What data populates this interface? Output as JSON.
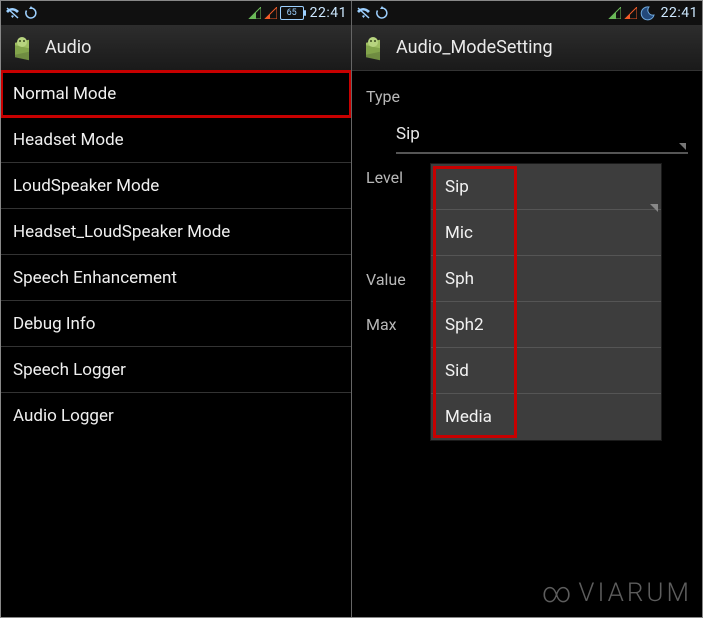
{
  "screens": {
    "left": {
      "statusbar": {
        "battery_pct": "65",
        "time": "22:41"
      },
      "actionbar": {
        "title": "Audio"
      },
      "menu_items": [
        "Normal Mode",
        "Headset Mode",
        "LoudSpeaker Mode",
        "Headset_LoudSpeaker Mode",
        "Speech Enhancement",
        "Debug Info",
        "Speech Logger",
        "Audio Logger"
      ],
      "highlighted_index": 0
    },
    "right": {
      "statusbar": {
        "time": "22:41"
      },
      "actionbar": {
        "title": "Audio_ModeSetting"
      },
      "form": {
        "type_label": "Type",
        "level_label": "Level",
        "value_label": "Value",
        "max_label": "Max",
        "type_selected": "Sip",
        "type_options": [
          "Sip",
          "Mic",
          "Sph",
          "Sph2",
          "Sid",
          "Media"
        ]
      }
    }
  },
  "watermark": "VIARUM"
}
